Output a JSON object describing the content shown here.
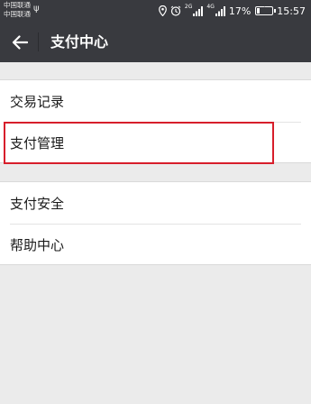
{
  "status_bar": {
    "carrier_1": "中国联通",
    "carrier_2": "中国联通",
    "net_tag_1": "2G",
    "net_tag_2": "4G",
    "battery": "17%",
    "battery_level": 0.17,
    "time": "15:57"
  },
  "header": {
    "title": "支付中心",
    "back_icon": "arrow-left-icon"
  },
  "menu": {
    "group_1": [
      {
        "label": "交易记录"
      },
      {
        "label": "支付管理"
      }
    ],
    "group_2": [
      {
        "label": "支付安全"
      },
      {
        "label": "帮助中心"
      }
    ]
  },
  "colors": {
    "toolbar": "#393a3f",
    "background": "#ebebeb",
    "highlight": "#d71e2b"
  }
}
